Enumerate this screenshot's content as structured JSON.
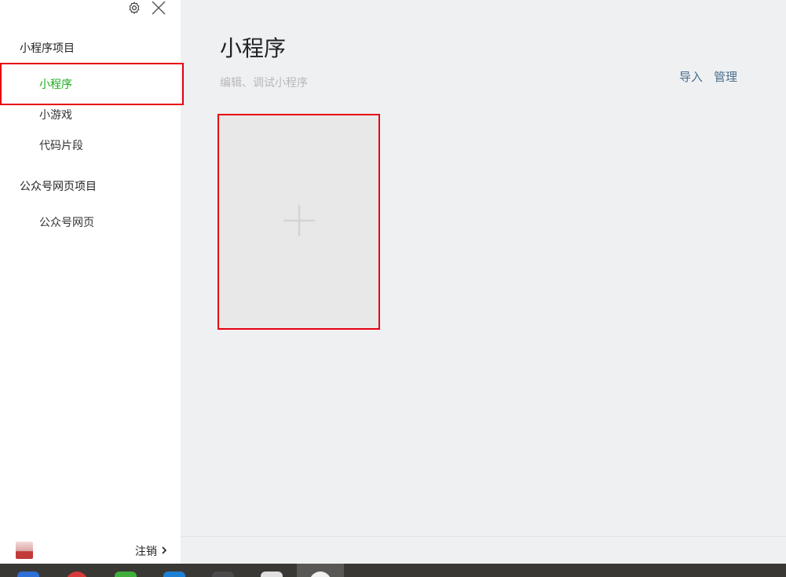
{
  "sidebar": {
    "sections": [
      {
        "title": "小程序项目",
        "items": [
          {
            "label": "小程序",
            "active": true
          },
          {
            "label": "小游戏",
            "active": false
          },
          {
            "label": "代码片段",
            "active": false
          }
        ]
      },
      {
        "title": "公众号网页项目",
        "items": [
          {
            "label": "公众号网页",
            "active": false
          }
        ]
      }
    ],
    "footer": {
      "logout_label": "注销"
    },
    "icons": {
      "settings": "gear-icon",
      "close": "close-icon"
    }
  },
  "main": {
    "title": "小程序",
    "subtitle": "编辑、调试小程序",
    "actions": {
      "import_label": "导入",
      "manage_label": "管理"
    },
    "create_card_icon": "plus-icon"
  },
  "colors": {
    "accent": "#1aad19",
    "link": "#4a6e8c",
    "highlight": "#e60012",
    "card": "#e8e8e8",
    "background": "#eff0f2"
  }
}
